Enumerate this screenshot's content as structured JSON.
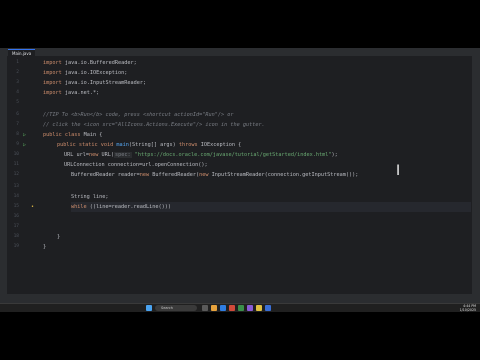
{
  "tab": {
    "label": "Main.java"
  },
  "code_lines": {
    "l1": {
      "num": "1",
      "kw": "import",
      "rest": " java.io.BufferedReader;"
    },
    "l2": {
      "num": "2",
      "kw": "import",
      "rest": " java.io.IOException;"
    },
    "l3": {
      "num": "3",
      "kw": "import",
      "rest": " java.io.InputStreamReader;"
    },
    "l4": {
      "num": "4",
      "kw": "import",
      "rest": " java.net.*;"
    },
    "l5": {
      "num": "5"
    },
    "l6": {
      "num": "6",
      "comment": "//TIP To <b>Run</b> code, press <shortcut actionId=\"Run\"/> or"
    },
    "l7": {
      "num": "7",
      "comment": "// click the <icon src=\"AllIcons.Actions.Execute\"/> icon in the gutter."
    },
    "l8": {
      "num": "8",
      "kw": "public class",
      "rest": " Main {"
    },
    "l9": {
      "num": "9",
      "kw": "public static void",
      "fn": " main",
      "rest": "(String[] args) ",
      "kw2": "throws",
      "rest2": " IOException {"
    },
    "l10": {
      "num": "10",
      "pre": "URL url=",
      "kw": "new",
      "fn": " URL",
      "hint": "spec:",
      "str": " \"https://docs.oracle.com/javase/tutorial/getStarted/index.html\"",
      "rest": ");"
    },
    "l11": {
      "num": "11",
      "text": "URLConnection connection=url.openConnection();"
    },
    "l12": {
      "num": "12",
      "pre": "BufferedReader reader=",
      "kw": "new",
      "rest": " BufferedReader(",
      "kw2": "new",
      "rest2": " InputStreamReader(connection.getInputStream());"
    },
    "l13": {
      "num": "13"
    },
    "l14": {
      "num": "14",
      "text": "String line;"
    },
    "l15": {
      "num": "15",
      "kw": "while",
      "rest": " ((line=reader.readLine()))"
    },
    "l16": {
      "num": "16"
    },
    "l17": {
      "num": "17"
    },
    "l18": {
      "num": "18",
      "text": "}"
    },
    "l19": {
      "num": "19",
      "text": "}"
    }
  },
  "taskbar": {
    "search_placeholder": "Search"
  },
  "tray": {
    "time": "4:44 PM",
    "date": "1/10/2025"
  }
}
